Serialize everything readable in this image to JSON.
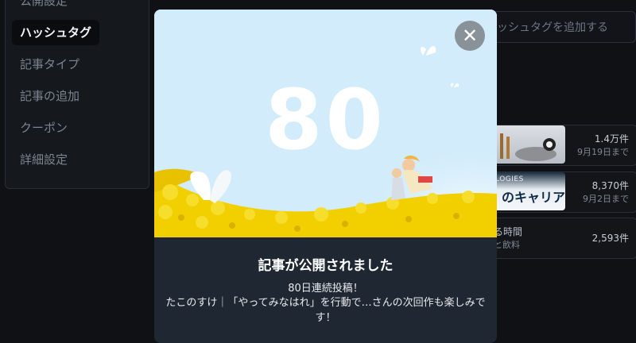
{
  "sidebar": {
    "items": [
      {
        "label": "公開設定",
        "active": false
      },
      {
        "label": "ハッシュタグ",
        "active": true
      },
      {
        "label": "記事タイプ",
        "active": false
      },
      {
        "label": "記事の追加",
        "active": false
      },
      {
        "label": "クーポン",
        "active": false
      },
      {
        "label": "詳細設定",
        "active": false
      }
    ]
  },
  "tags": {
    "input_placeholder": "ッシュタグを追加する",
    "rows": [
      {
        "count": "1.4万件",
        "sub": "9月19日まで"
      },
      {
        "thumb_tag": "LOGIES",
        "thumb_text": "のキャリア",
        "count": "8,370件",
        "sub": "9月2日まで"
      },
      {
        "text": "る時間",
        "text2": "と飲料",
        "count": "2,593件"
      }
    ]
  },
  "modal": {
    "streak_number": "80",
    "close_icon": "close-icon",
    "title": "記事が公開されました",
    "subtitle": "80日連続投稿！",
    "body": "たこのすけ｜「やってみなはれ」を行動で…さんの次回作も楽しみです！"
  },
  "colors": {
    "sky": "#d2ecfb",
    "flowers": "#f1cf00",
    "modal_footer": "#1f2832",
    "page_bg": "#0f1115"
  }
}
